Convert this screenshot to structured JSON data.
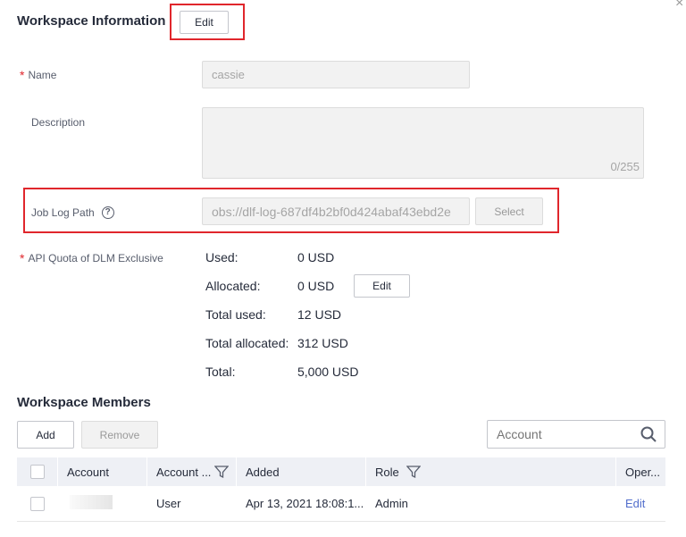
{
  "workspace_info": {
    "title": "Workspace Information",
    "edit_label": "Edit",
    "name_label": "Name",
    "name_value": "cassie",
    "description_label": "Description",
    "description_counter": "0/255",
    "job_log_label": "Job Log Path",
    "job_log_value": "obs://dlf-log-687df4b2bf0d424abaf43ebd2e",
    "select_label": "Select",
    "quota_label": "API Quota of DLM Exclusive",
    "quota": {
      "used_label": "Used:",
      "used_value": "0 USD",
      "allocated_label": "Allocated:",
      "allocated_value": "0 USD",
      "allocated_edit": "Edit",
      "total_used_label": "Total used:",
      "total_used_value": "12 USD",
      "total_allocated_label": "Total allocated:",
      "total_allocated_value": "312 USD",
      "total_label": "Total:",
      "total_value": "5,000 USD"
    }
  },
  "members": {
    "title": "Workspace Members",
    "add_label": "Add",
    "remove_label": "Remove",
    "search_placeholder": "Account",
    "columns": [
      "Account",
      "Account ...",
      "Added",
      "Role",
      "Oper..."
    ],
    "rows": [
      {
        "account": "",
        "account_type": "User",
        "added": "Apr 13, 2021 18:08:1...",
        "role": "Admin",
        "operation": "Edit"
      }
    ]
  },
  "icons": {
    "close": "close-icon",
    "help": "help-icon",
    "search": "search-icon",
    "filter": "filter-icon"
  },
  "colors": {
    "accent_red": "#e0262c",
    "link_blue": "#526ecc",
    "header_bg": "#eef0f5"
  }
}
